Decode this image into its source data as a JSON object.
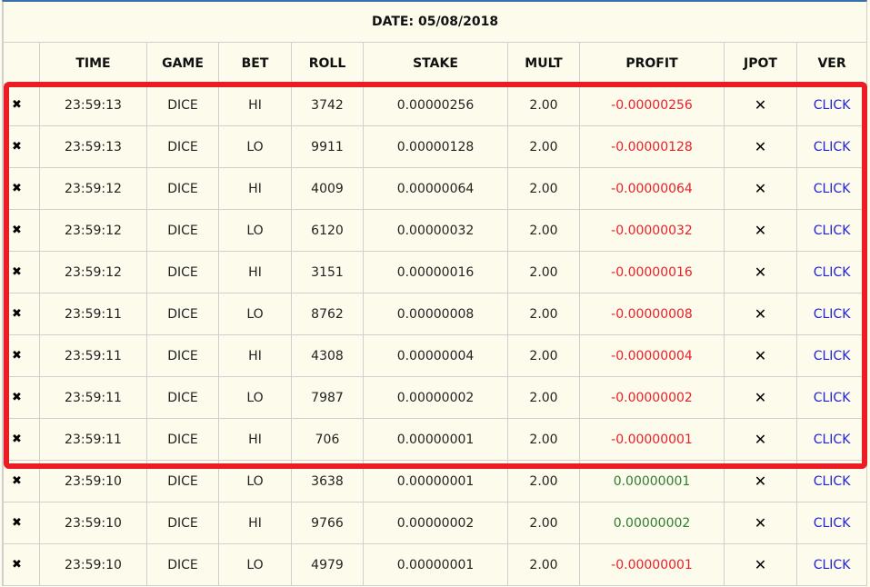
{
  "date_label": "DATE: 05/08/2018",
  "columns": [
    "",
    "TIME",
    "GAME",
    "BET",
    "ROLL",
    "STAKE",
    "MULT",
    "PROFIT",
    "JPOT",
    "VER"
  ],
  "row_icon": "✖",
  "jpot_icon": "✕",
  "colors": {
    "loss": "#e8202a",
    "win": "#2f7d2f",
    "link": "#2020dd",
    "highlight": "#ec1c24"
  },
  "rows": [
    {
      "time": "23:59:13",
      "game": "DICE",
      "bet": "HI",
      "roll": "3742",
      "stake": "0.00000256",
      "mult": "2.00",
      "profit": "-0.00000256",
      "result": "loss",
      "ver": "CLICK"
    },
    {
      "time": "23:59:13",
      "game": "DICE",
      "bet": "LO",
      "roll": "9911",
      "stake": "0.00000128",
      "mult": "2.00",
      "profit": "-0.00000128",
      "result": "loss",
      "ver": "CLICK"
    },
    {
      "time": "23:59:12",
      "game": "DICE",
      "bet": "HI",
      "roll": "4009",
      "stake": "0.00000064",
      "mult": "2.00",
      "profit": "-0.00000064",
      "result": "loss",
      "ver": "CLICK"
    },
    {
      "time": "23:59:12",
      "game": "DICE",
      "bet": "LO",
      "roll": "6120",
      "stake": "0.00000032",
      "mult": "2.00",
      "profit": "-0.00000032",
      "result": "loss",
      "ver": "CLICK"
    },
    {
      "time": "23:59:12",
      "game": "DICE",
      "bet": "HI",
      "roll": "3151",
      "stake": "0.00000016",
      "mult": "2.00",
      "profit": "-0.00000016",
      "result": "loss",
      "ver": "CLICK"
    },
    {
      "time": "23:59:11",
      "game": "DICE",
      "bet": "LO",
      "roll": "8762",
      "stake": "0.00000008",
      "mult": "2.00",
      "profit": "-0.00000008",
      "result": "loss",
      "ver": "CLICK"
    },
    {
      "time": "23:59:11",
      "game": "DICE",
      "bet": "HI",
      "roll": "4308",
      "stake": "0.00000004",
      "mult": "2.00",
      "profit": "-0.00000004",
      "result": "loss",
      "ver": "CLICK"
    },
    {
      "time": "23:59:11",
      "game": "DICE",
      "bet": "LO",
      "roll": "7987",
      "stake": "0.00000002",
      "mult": "2.00",
      "profit": "-0.00000002",
      "result": "loss",
      "ver": "CLICK"
    },
    {
      "time": "23:59:11",
      "game": "DICE",
      "bet": "HI",
      "roll": "706",
      "stake": "0.00000001",
      "mult": "2.00",
      "profit": "-0.00000001",
      "result": "loss",
      "ver": "CLICK"
    },
    {
      "time": "23:59:10",
      "game": "DICE",
      "bet": "LO",
      "roll": "3638",
      "stake": "0.00000001",
      "mult": "2.00",
      "profit": "0.00000001",
      "result": "win",
      "ver": "CLICK"
    },
    {
      "time": "23:59:10",
      "game": "DICE",
      "bet": "HI",
      "roll": "9766",
      "stake": "0.00000002",
      "mult": "2.00",
      "profit": "0.00000002",
      "result": "win",
      "ver": "CLICK"
    },
    {
      "time": "23:59:10",
      "game": "DICE",
      "bet": "LO",
      "roll": "4979",
      "stake": "0.00000001",
      "mult": "2.00",
      "profit": "-0.00000001",
      "result": "loss",
      "ver": "CLICK"
    }
  ]
}
